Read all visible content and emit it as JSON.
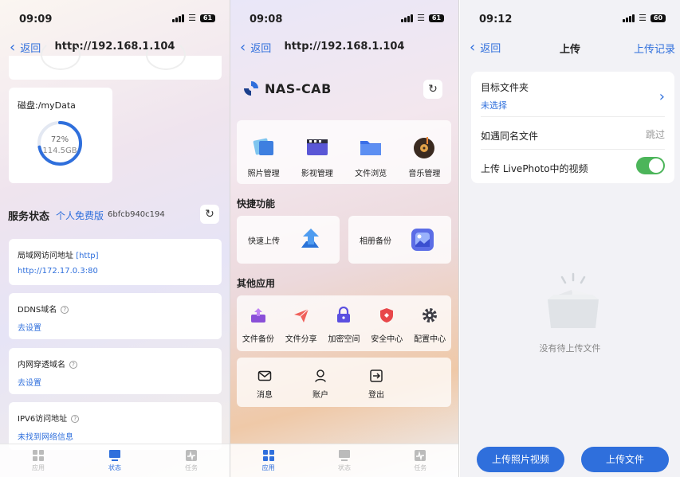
{
  "screen1": {
    "time": "09:09",
    "battery": "61",
    "back_label": "返回",
    "title": "http://192.168.1.104",
    "disk": {
      "label": "磁盘:/myData",
      "percent": "72%",
      "percent_value": 72,
      "size": "114.5GB"
    },
    "service": {
      "heading": "服务状态",
      "edition": "个人免费版",
      "id": "6bfcb940c194"
    },
    "cards": [
      {
        "label": "局域网访问地址",
        "tag": "[http]",
        "value": "http://172.17.0.3:80"
      },
      {
        "label": "DDNS域名",
        "value": "去设置"
      },
      {
        "label": "内网穿透域名",
        "value": "去设置"
      },
      {
        "label": "IPV6访问地址",
        "value": "未找到网络信息"
      }
    ],
    "tabs": [
      {
        "label": "应用",
        "icon": "grid-icon",
        "active": false
      },
      {
        "label": "状态",
        "icon": "monitor-icon",
        "active": true
      },
      {
        "label": "任务",
        "icon": "pulse-icon",
        "active": false
      }
    ]
  },
  "screen2": {
    "time": "09:08",
    "battery": "61",
    "back_label": "返回",
    "title": "http://192.168.1.104",
    "logo_text": "NAS-CAB",
    "main_apps": [
      {
        "label": "照片管理",
        "icon": "photos-icon"
      },
      {
        "label": "影视管理",
        "icon": "video-icon"
      },
      {
        "label": "文件浏览",
        "icon": "folder-icon"
      },
      {
        "label": "音乐管理",
        "icon": "music-icon"
      }
    ],
    "quick_title": "快捷功能",
    "quick": [
      {
        "label": "快速上传",
        "icon": "upload-arrow-icon"
      },
      {
        "label": "相册备份",
        "icon": "album-icon"
      }
    ],
    "other_title": "其他应用",
    "other_apps": [
      {
        "label": "文件备份",
        "icon": "backup-icon"
      },
      {
        "label": "文件分享",
        "icon": "share-icon"
      },
      {
        "label": "加密空间",
        "icon": "lock-icon"
      },
      {
        "label": "安全中心",
        "icon": "shield-icon"
      },
      {
        "label": "配置中心",
        "icon": "gear-icon"
      }
    ],
    "account_items": [
      {
        "label": "消息",
        "icon": "mail-icon"
      },
      {
        "label": "账户",
        "icon": "user-icon"
      },
      {
        "label": "登出",
        "icon": "logout-icon"
      }
    ],
    "tabs": [
      {
        "label": "应用",
        "icon": "grid-icon",
        "active": true
      },
      {
        "label": "状态",
        "icon": "monitor-icon",
        "active": false
      },
      {
        "label": "任务",
        "icon": "pulse-icon",
        "active": false
      }
    ]
  },
  "screen3": {
    "time": "09:12",
    "battery": "60",
    "back_label": "返回",
    "title": "上传",
    "right_action": "上传记录",
    "target_folder_label": "目标文件夹",
    "target_folder_value": "未选择",
    "duplicate_label": "如遇同名文件",
    "duplicate_value": "跳过",
    "livephoto_label": "上传 LivePhoto中的视频",
    "livephoto_enabled": true,
    "empty_text": "没有待上传文件",
    "btn_photos": "上传照片视频",
    "btn_files": "上传文件"
  },
  "colors": {
    "accent": "#2f6fdc",
    "toggle_on": "#4cb55a"
  }
}
